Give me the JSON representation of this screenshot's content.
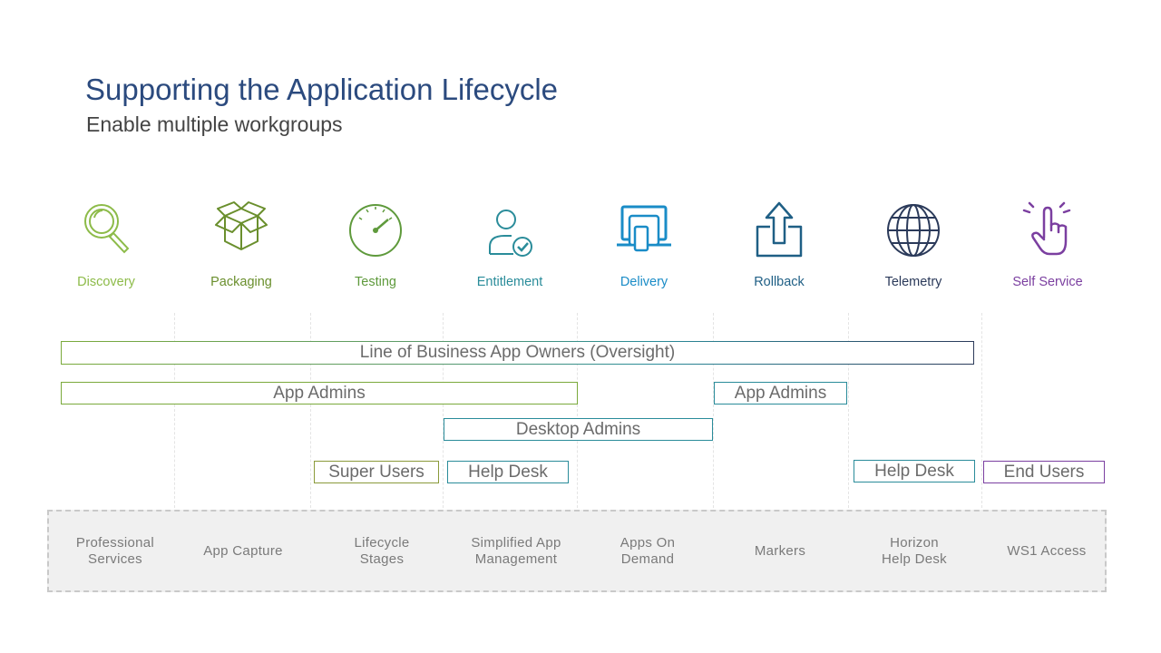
{
  "title": "Supporting the Application Lifecycle",
  "subtitle": "Enable multiple workgroups",
  "stages": [
    {
      "label": "Discovery",
      "icon": "magnifier-icon",
      "color": "#8dbb49"
    },
    {
      "label": "Packaging",
      "icon": "package-box-icon",
      "color": "#6a8f2d"
    },
    {
      "label": "Testing",
      "icon": "gauge-icon",
      "color": "#5f9a3c"
    },
    {
      "label": "Entitlement",
      "icon": "user-check-icon",
      "color": "#2a8c9a"
    },
    {
      "label": "Delivery",
      "icon": "devices-icon",
      "color": "#1a8cc7"
    },
    {
      "label": "Rollback",
      "icon": "share-up-icon",
      "color": "#1f5f85"
    },
    {
      "label": "Telemetry",
      "icon": "globe-icon",
      "color": "#2b3a5a"
    },
    {
      "label": "Self Service",
      "icon": "touch-hand-icon",
      "color": "#7b3fa0"
    }
  ],
  "workgroups": [
    {
      "label": "Line of Business App Owners (Oversight)",
      "border": "gradient-green-navy"
    },
    {
      "label": "App Admins",
      "border": "#7aaa3b"
    },
    {
      "label": "App Admins",
      "border": "#2a8c9a"
    },
    {
      "label": "Desktop Admins",
      "border": "#2a8c9a"
    },
    {
      "label": "Super Users",
      "border": "#8a9a3a"
    },
    {
      "label": "Help Desk",
      "border": "#2a8c9a"
    },
    {
      "label": "Help Desk",
      "border": "#2a8c9a"
    },
    {
      "label": "End Users",
      "border": "#7b3fa0"
    }
  ],
  "tools": [
    {
      "label": "Professional\nServices"
    },
    {
      "label": "App Capture"
    },
    {
      "label": "Lifecycle\nStages"
    },
    {
      "label": "Simplified App\nManagement"
    },
    {
      "label": "Apps On\nDemand"
    },
    {
      "label": "Markers"
    },
    {
      "label": "Horizon\nHelp Desk"
    },
    {
      "label": "WS1 Access"
    }
  ]
}
